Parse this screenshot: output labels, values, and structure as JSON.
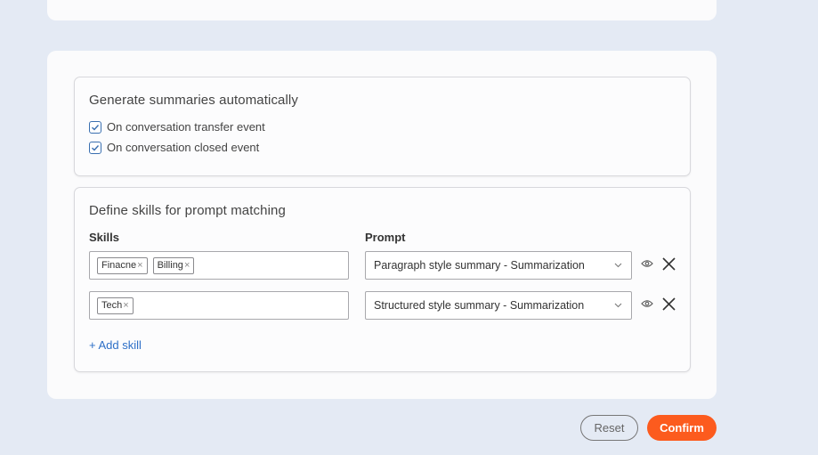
{
  "auto_summaries": {
    "title": "Generate summaries automatically",
    "options": [
      {
        "label": "On conversation transfer event",
        "checked": true
      },
      {
        "label": "On conversation closed event",
        "checked": true
      }
    ]
  },
  "skills_section": {
    "title": "Define skills for prompt matching",
    "skills_label": "Skills",
    "prompt_label": "Prompt",
    "rows": [
      {
        "skills": [
          "Finacne",
          "Billing"
        ],
        "prompt": "Paragraph style summary - Summarization"
      },
      {
        "skills": [
          "Tech"
        ],
        "prompt": "Structured style summary - Summarization"
      }
    ],
    "add_skill_label": "+ Add skill",
    "chip_remove_glyph": "×"
  },
  "footer": {
    "reset_label": "Reset",
    "confirm_label": "Confirm"
  },
  "colors": {
    "accent": "#fc5b1e",
    "link": "#2d6fc7",
    "checkbox": "#3a6fb0",
    "background": "#e4eaf4"
  }
}
